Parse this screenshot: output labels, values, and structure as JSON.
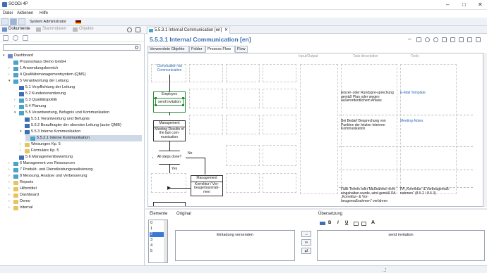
{
  "window": {
    "title": "SCODi 4P",
    "min": "–",
    "max": "□",
    "close": "✕"
  },
  "menu": [
    "Datei",
    "Aktionen",
    "Hilfe"
  ],
  "user": {
    "label": "System Administrator"
  },
  "left_tabs": {
    "documents": "Dokumente",
    "master": "Stammdaten",
    "objects": "Objekte"
  },
  "tree": [
    {
      "label": "Dashboard",
      "lvl": 0,
      "exp": "▾",
      "icon": "doc"
    },
    {
      "label": "Prozesshaus Demo GmbH",
      "lvl": 1,
      "exp": "",
      "icon": "proc"
    },
    {
      "label": "1 Anwendungsbereich",
      "lvl": 1,
      "exp": "›",
      "icon": "proc"
    },
    {
      "label": "4 Qualitätsmanagementsystem (QMS)",
      "lvl": 1,
      "exp": "›",
      "icon": "proc"
    },
    {
      "label": "5 Verantwortung der Leitung",
      "lvl": 1,
      "exp": "▾",
      "icon": "proc"
    },
    {
      "label": "5.1 Verpflichtung der Leitung",
      "lvl": 2,
      "exp": "",
      "icon": "blue"
    },
    {
      "label": "5.2 Kundenorientierung",
      "lvl": 2,
      "exp": "",
      "icon": "blue"
    },
    {
      "label": "5.3 Qualitätspolitik",
      "lvl": 2,
      "exp": "›",
      "icon": "proc"
    },
    {
      "label": "5.4 Planung",
      "lvl": 2,
      "exp": "›",
      "icon": "proc"
    },
    {
      "label": "5.5 Verantwortung, Befugnis und Kommunikation",
      "lvl": 2,
      "exp": "▾",
      "icon": "proc"
    },
    {
      "label": "5.5.1 Verantwortung und Befugnis",
      "lvl": 3,
      "exp": "",
      "icon": "blue"
    },
    {
      "label": "5.5.2 Beauftragter der obersten Leitung (autor QMB)",
      "lvl": 3,
      "exp": "",
      "icon": "blue"
    },
    {
      "label": "5.5.3 Interne Kommunikation",
      "lvl": 3,
      "exp": "▾",
      "icon": "blue"
    },
    {
      "label": "5.5.3.1 Interne Kommunikation",
      "lvl": 4,
      "exp": "",
      "icon": "proc",
      "sel": true
    },
    {
      "label": "Weisungen Kp. 5",
      "lvl": 3,
      "exp": "›",
      "icon": "fold"
    },
    {
      "label": "Formulare Kp. 5",
      "lvl": 3,
      "exp": "›",
      "icon": "fold"
    },
    {
      "label": "5.6 Managementbewertung",
      "lvl": 2,
      "exp": "",
      "icon": "blue"
    },
    {
      "label": "6 Management von Ressourcen",
      "lvl": 1,
      "exp": "›",
      "icon": "proc"
    },
    {
      "label": "7 Produkt- und Dienstleistungsrealisierung",
      "lvl": 1,
      "exp": "›",
      "icon": "proc"
    },
    {
      "label": "8 Messung, Analyse und Verbesserung",
      "lvl": 1,
      "exp": "›",
      "icon": "proc"
    },
    {
      "label": "Reports",
      "lvl": 1,
      "exp": "›",
      "icon": "fold"
    },
    {
      "label": "Hilfsmittel",
      "lvl": 1,
      "exp": "›",
      "icon": "fold"
    },
    {
      "label": "Dashboard",
      "lvl": 1,
      "exp": "›",
      "icon": "fold"
    },
    {
      "label": "Demo",
      "lvl": 1,
      "exp": "›",
      "icon": "fold"
    },
    {
      "label": "Internal",
      "lvl": 1,
      "exp": "›",
      "icon": "fold"
    }
  ],
  "doc_tab": "5.5.3.1 Internal Communication [en]",
  "doc_title": "5.5.3.1 Internal Communication [en]",
  "sub_tabs": [
    "Verwendete Objekte",
    "Folder",
    "Prozess Flow",
    "Flow"
  ],
  "columns": {
    "input": "Input/Output",
    "task": "Task description",
    "tools": "Tools"
  },
  "diagram": {
    "start": "Convocation via Communication",
    "employee": "Employee",
    "send": "send invitation",
    "mgmt1": "Management",
    "meeting": "Meeting Results of the last com-munication",
    "decision": "All steps done?",
    "no": "No",
    "yes": "Yes",
    "mgmt2": "Management",
    "korrektur": "Korrektur / Vor-beugemassnah-men"
  },
  "desc": {
    "d1": "Einzel- oder Rundspre-sprechung gemäß Plan oder wegen außerordentlichem Anlass",
    "t1": "E-Mail Template",
    "d2": "Bei Bedarf Besprechung von Punkten der letzten internen Kommunikation",
    "t2": "Meeting-Notes",
    "d3": "Falls Termin oder Maßnahme nicht eingehalten wurde, wird gemäß PA „Korrektur- & Vor-beugemaßnahmen“ verfahren",
    "t3": "PA „Korrektur- & Vorbeugemaß-nahmen“ (8.5.2 / 8.5.3)"
  },
  "bottom": {
    "elements_label": "Elemente",
    "items": [
      "0",
      "1",
      "2",
      "3",
      "4",
      "5"
    ],
    "original_label": "Original",
    "original_text": "Einladung versenden",
    "translation_label": "Übersetzung",
    "translation_text": "send invitation",
    "fmt": [
      "B",
      "I",
      "U"
    ]
  }
}
